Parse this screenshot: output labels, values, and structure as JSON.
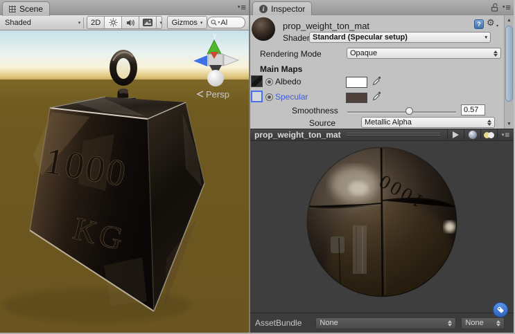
{
  "colors": {
    "specular_label_blue": "#3f5bd8",
    "selection_border_blue": "#4a72e8",
    "albedo_swatch": "#ffffff",
    "specular_swatch": "#4e403a",
    "tag_button_blue": "#3a79d1",
    "ground_brown": "#6a5420",
    "sky_top_blue": "#c6e0e9",
    "preview_background": "#3e3e3e"
  },
  "scene": {
    "tab_label": "Scene",
    "toolbar": {
      "draw_mode": "Shaded",
      "toggle_2d": "2D",
      "gizmos": "Gizmos",
      "search_text": "Al"
    },
    "viewport": {
      "axis_label": "y",
      "camera_label": "Persp",
      "weight_text_line1": "1000",
      "weight_text_line2": "KG"
    }
  },
  "inspector": {
    "tab_label": "Inspector",
    "material_name": "prop_weight_ton_mat",
    "shader_label": "Shader",
    "shader_value": "Standard (Specular setup)",
    "rendering_mode_label": "Rendering Mode",
    "rendering_mode_value": "Opaque",
    "main_maps_heading": "Main Maps",
    "albedo_label": "Albedo",
    "specular_label": "Specular",
    "smoothness_label": "Smoothness",
    "smoothness_value": "0.57",
    "source_label": "Source",
    "source_value": "Metallic Alpha",
    "preview": {
      "title": "prop_weight_ton_mat",
      "sphere_text": "1000"
    },
    "assetbundle": {
      "label": "AssetBundle",
      "bundle_value": "None",
      "variant_value": "None"
    }
  }
}
